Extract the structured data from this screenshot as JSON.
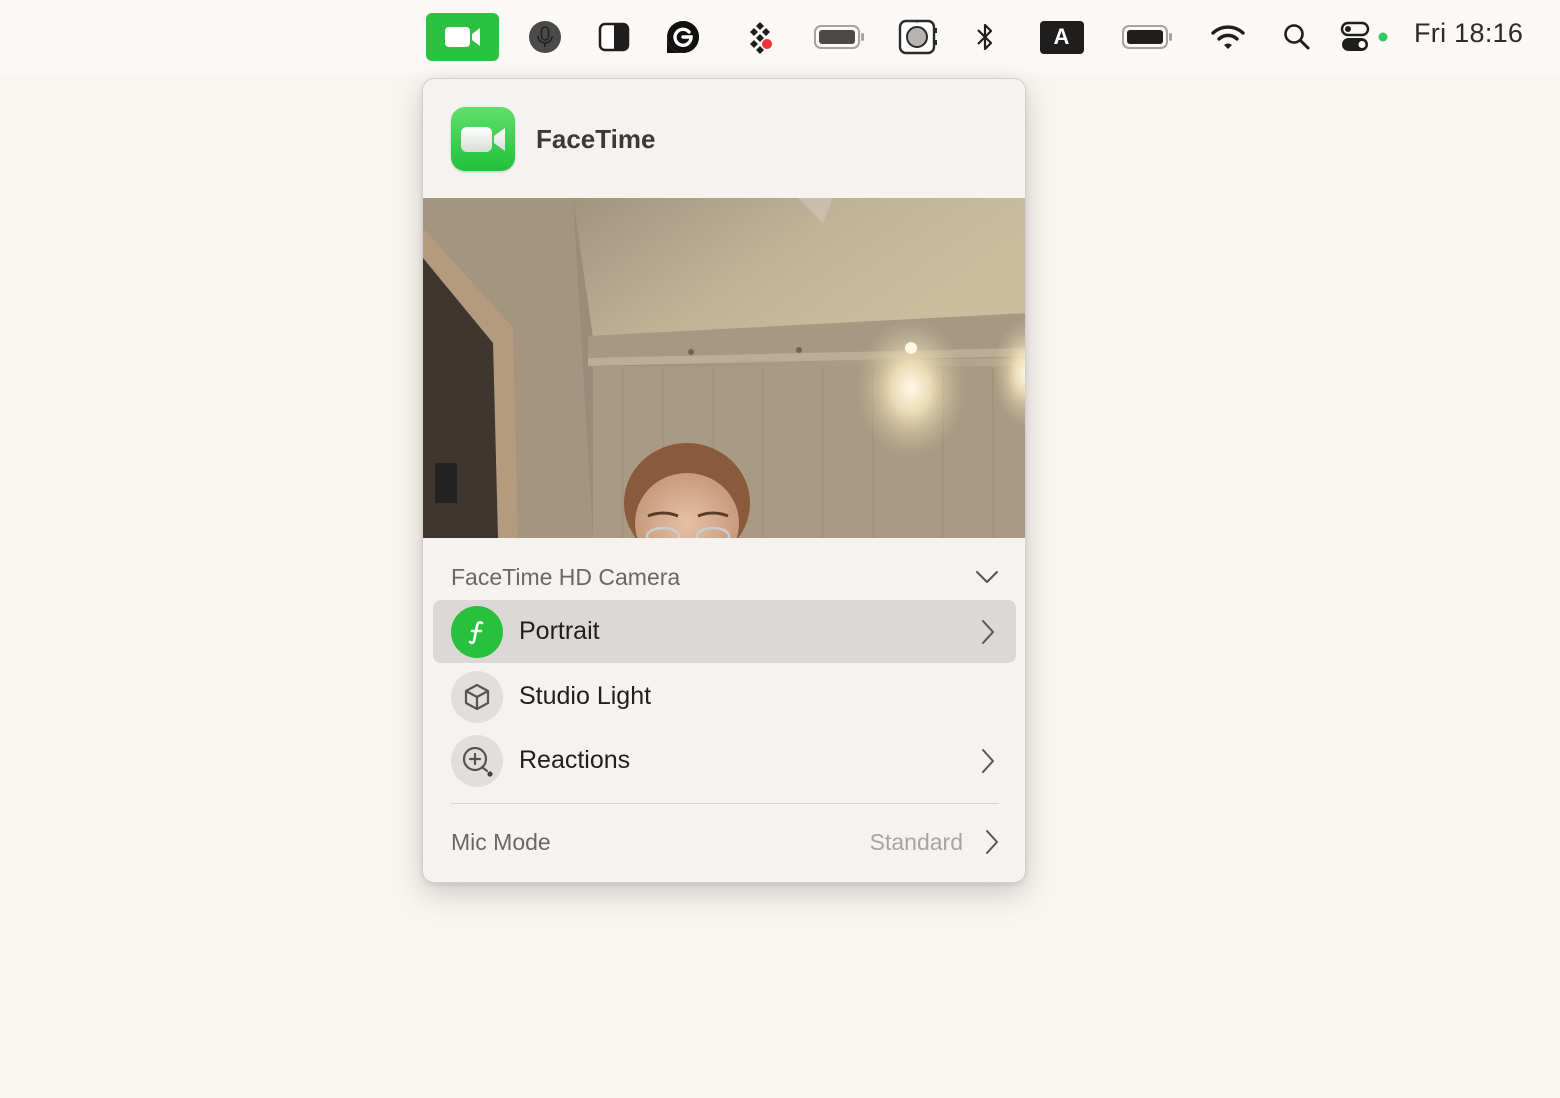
{
  "menubar": {
    "items": [
      {
        "name": "facetime-video-icon",
        "active": true
      },
      {
        "name": "microphone-icon"
      },
      {
        "name": "display-contrast-icon"
      },
      {
        "name": "grammarly-icon"
      },
      {
        "name": "app-grid-icon"
      },
      {
        "name": "battery-icon-1"
      },
      {
        "name": "screenshot-icon"
      },
      {
        "name": "bluetooth-icon"
      },
      {
        "name": "input-source-icon",
        "label": "A"
      },
      {
        "name": "battery-icon-2"
      },
      {
        "name": "wifi-icon"
      },
      {
        "name": "spotlight-search-icon"
      },
      {
        "name": "control-center-icon"
      }
    ],
    "clock": "Fri 18:16",
    "colors": {
      "facetime_green": "#2ac23f",
      "status_dot": "#34c759"
    }
  },
  "popover": {
    "app_name": "FaceTime",
    "camera": {
      "selected": "FaceTime HD Camera"
    },
    "effects": [
      {
        "label": "Portrait",
        "icon": "portrait-f-icon",
        "enabled": true,
        "has_submenu": true
      },
      {
        "label": "Studio Light",
        "icon": "cube-icon",
        "enabled": false,
        "has_submenu": false
      },
      {
        "label": "Reactions",
        "icon": "reactions-icon",
        "enabled": false,
        "has_submenu": true
      }
    ],
    "mic_mode": {
      "label": "Mic Mode",
      "value": "Standard"
    }
  }
}
